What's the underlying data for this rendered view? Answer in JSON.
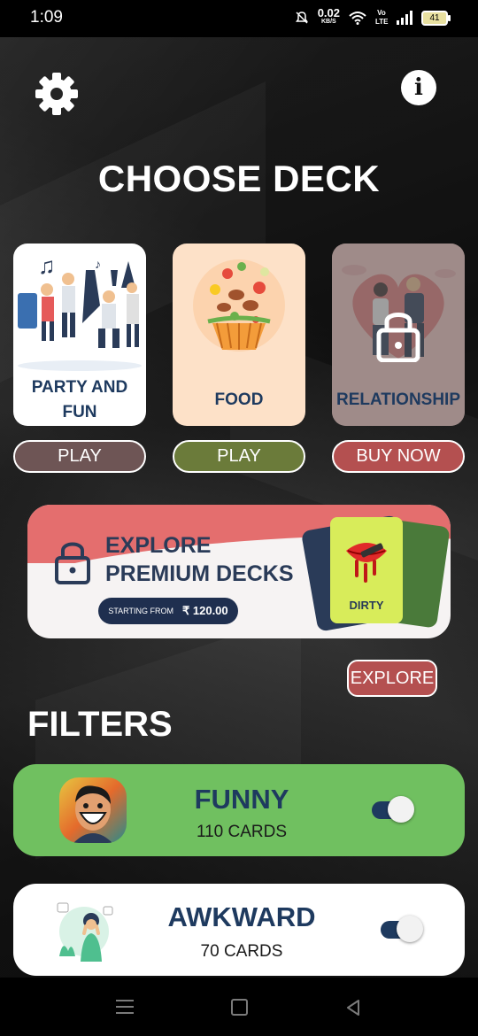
{
  "status_bar": {
    "time": "1:09",
    "speed_value": "0.02",
    "speed_unit": "KB/S",
    "network": "Vo LTE",
    "battery": "41"
  },
  "header": {
    "settings_icon": "gear-icon",
    "info_icon": "info-icon",
    "info_glyph": "i",
    "title": "CHOOSE DECK"
  },
  "decks": [
    {
      "label": "PARTY AND FUN",
      "button": "PLAY",
      "button_color": "#6e5555",
      "locked": false
    },
    {
      "label": "FOOD",
      "button": "PLAY",
      "button_color": "#6b7b3a",
      "locked": false
    },
    {
      "label": "RELATIONSHIP",
      "button": "BUY NOW",
      "button_color": "#b45050",
      "locked": true
    }
  ],
  "premium_banner": {
    "line1": "EXPLORE",
    "line2": "PREMIUM DECKS",
    "price_prefix": "STARTING FROM",
    "price": "₹ 120.00",
    "card_label": "DIRTY",
    "explore_button": "EXPLORE"
  },
  "filters": {
    "heading": "FILTERS",
    "items": [
      {
        "name": "FUNNY",
        "count": "110 CARDS",
        "enabled": true,
        "bg": "#70c060"
      },
      {
        "name": "AWKWARD",
        "count": "70 CARDS",
        "enabled": true,
        "bg": "#ffffff"
      }
    ]
  },
  "colors": {
    "navy": "#1e3a5f",
    "banner_red": "#e46e6e",
    "button_red": "#b45050"
  },
  "navigation": {
    "menu_icon": "menu-icon",
    "home_icon": "home-icon",
    "back_icon": "back-icon"
  }
}
